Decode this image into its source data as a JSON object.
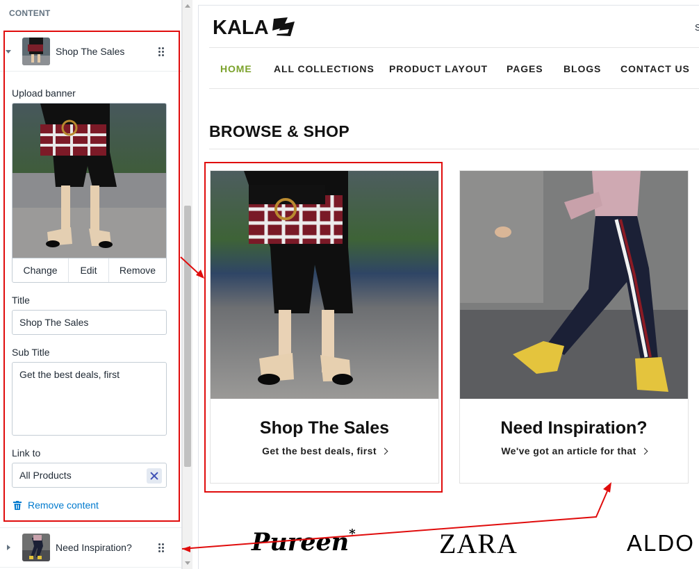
{
  "editor": {
    "section_heading": "CONTENT",
    "block_open": {
      "title": "Shop The Sales"
    },
    "banner_label": "Upload banner",
    "banner_actions": [
      "Change",
      "Edit",
      "Remove"
    ],
    "title_label": "Title",
    "title_value": "Shop The Sales",
    "subtitle_label": "Sub Title",
    "subtitle_value": "Get the best deals, first",
    "link_label": "Link to",
    "link_value": "All Products",
    "remove_content": "Remove content",
    "block_closed": {
      "title": "Need Inspiration?"
    }
  },
  "preview": {
    "logo_text": "KALA",
    "header_cut_text": "S",
    "nav": [
      "HOME",
      "ALL COLLECTIONS",
      "PRODUCT LAYOUT",
      "PAGES",
      "BLOGS",
      "CONTACT US"
    ],
    "active_nav": "HOME",
    "section_title": "BROWSE & SHOP",
    "cards": [
      {
        "title": "Shop The Sales",
        "subtitle": "Get the best deals, first"
      },
      {
        "title": "Need Inspiration?",
        "subtitle": "We've got an article for that"
      }
    ],
    "brands": [
      "Pureen",
      "ZARA",
      "ALDO"
    ]
  },
  "colors": {
    "accent_nav": "#7ba22b",
    "annotation_red": "#e00c0c",
    "link_blue": "#007ace"
  },
  "icons": [
    "chevron-down-icon",
    "chevron-right-icon",
    "drag-handle-icon",
    "close-icon",
    "trash-icon",
    "chevron-right-icon"
  ]
}
